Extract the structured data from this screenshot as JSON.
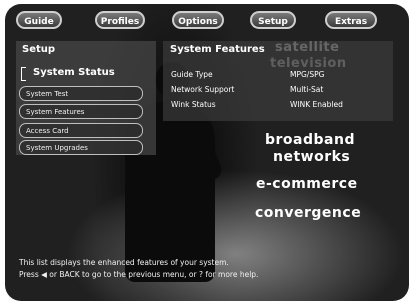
{
  "nav": [
    "Guide",
    "Profiles",
    "Options",
    "Setup",
    "Extras"
  ],
  "setup": {
    "title": "Setup",
    "header_item": "System Status",
    "items": [
      "System Test",
      "System Features",
      "Access Card",
      "System Upgrades"
    ]
  },
  "features": {
    "title": "System Features",
    "rows": [
      {
        "label": "Guide Type",
        "value": "MPG/SPG"
      },
      {
        "label": "Network Support",
        "value": "Multi-Sat"
      },
      {
        "label": "Wink Status",
        "value": "WINK Enabled"
      }
    ]
  },
  "taglines": [
    "satellite",
    "television",
    "broadband",
    "networks",
    "e-commerce",
    "convergence"
  ],
  "help": {
    "line1": "This list displays the enhanced features of your system.",
    "line2": "Press ◀ or BACK to go to the previous menu, or ? for more help."
  }
}
